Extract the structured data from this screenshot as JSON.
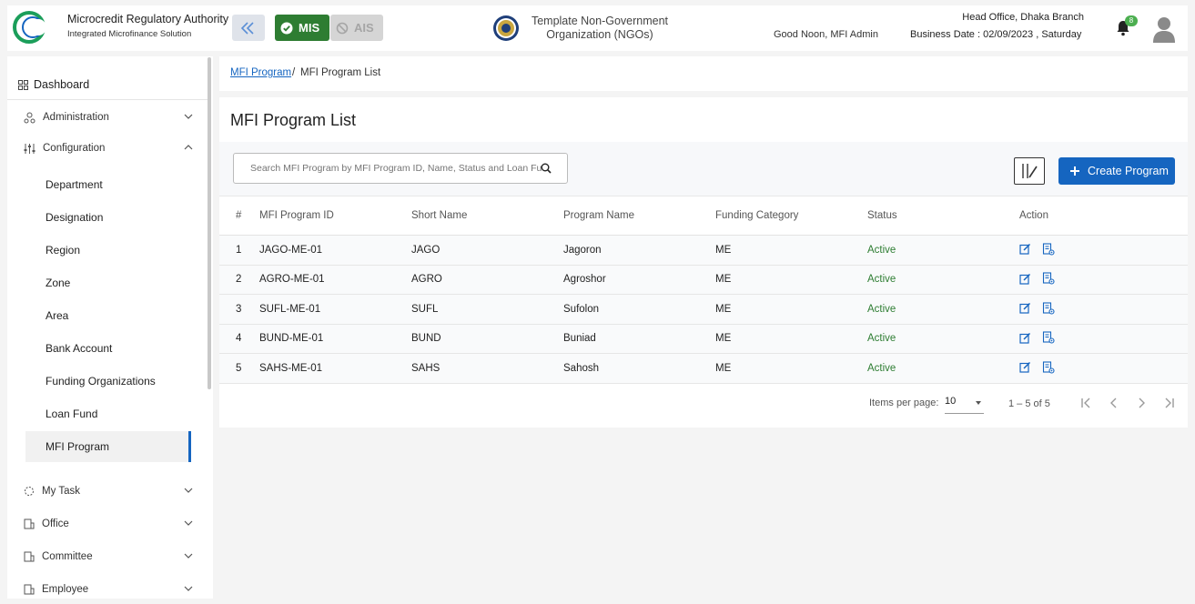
{
  "header": {
    "org_title": "Microcredit Regulatory Authority",
    "org_subtitle": "Integrated Microfinance Solution",
    "mis_label": "MIS",
    "ais_label": "AIS",
    "ngo_line1": "Template Non-Government",
    "ngo_line2": "Organization (NGOs)",
    "greeting": "Good Noon, MFI Admin",
    "branch": "Head Office, Dhaka Branch",
    "business_date": "Business Date : 02/09/2023 , Saturday",
    "notification_count": "8"
  },
  "sidebar": {
    "dashboard": "Dashboard",
    "items": [
      {
        "label": "Administration"
      },
      {
        "label": "Configuration"
      },
      {
        "label": "My Task"
      },
      {
        "label": "Office"
      },
      {
        "label": "Committee"
      },
      {
        "label": "Employee"
      }
    ],
    "sub_items": [
      {
        "label": "Department"
      },
      {
        "label": "Designation"
      },
      {
        "label": "Region"
      },
      {
        "label": "Zone"
      },
      {
        "label": "Area"
      },
      {
        "label": "Bank Account"
      },
      {
        "label": "Funding Organizations"
      },
      {
        "label": "Loan Fund"
      },
      {
        "label": "MFI Program"
      }
    ]
  },
  "breadcrumb": {
    "link": "MFI Program",
    "separator": "/",
    "current": "MFI Program List"
  },
  "main": {
    "title": "MFI Program List",
    "search_placeholder": "Search MFI Program by MFI Program ID, Name, Status and Loan Fund",
    "create_label": "Create Program"
  },
  "table": {
    "headers": [
      "#",
      "MFI Program ID",
      "Short Name",
      "Program Name",
      "Funding Category",
      "Status",
      "Action"
    ],
    "rows": [
      {
        "n": "1",
        "id": "JAGO-ME-01",
        "short": "JAGO",
        "name": "Jagoron",
        "cat": "ME",
        "status": "Active"
      },
      {
        "n": "2",
        "id": "AGRO-ME-01",
        "short": "AGRO",
        "name": "Agroshor",
        "cat": "ME",
        "status": "Active"
      },
      {
        "n": "3",
        "id": "SUFL-ME-01",
        "short": "SUFL",
        "name": "Sufolon",
        "cat": "ME",
        "status": "Active"
      },
      {
        "n": "4",
        "id": "BUND-ME-01",
        "short": "BUND",
        "name": "Buniad",
        "cat": "ME",
        "status": "Active"
      },
      {
        "n": "5",
        "id": "SAHS-ME-01",
        "short": "SAHS",
        "name": "Sahosh",
        "cat": "ME",
        "status": "Active"
      }
    ]
  },
  "pagination": {
    "items_per_page_label": "Items per page:",
    "items_per_page": "10",
    "range": "1 – 5 of 5"
  },
  "colors": {
    "primary": "#1565c0",
    "mis_green": "#2e7d32",
    "status_active": "#2e7d32"
  }
}
